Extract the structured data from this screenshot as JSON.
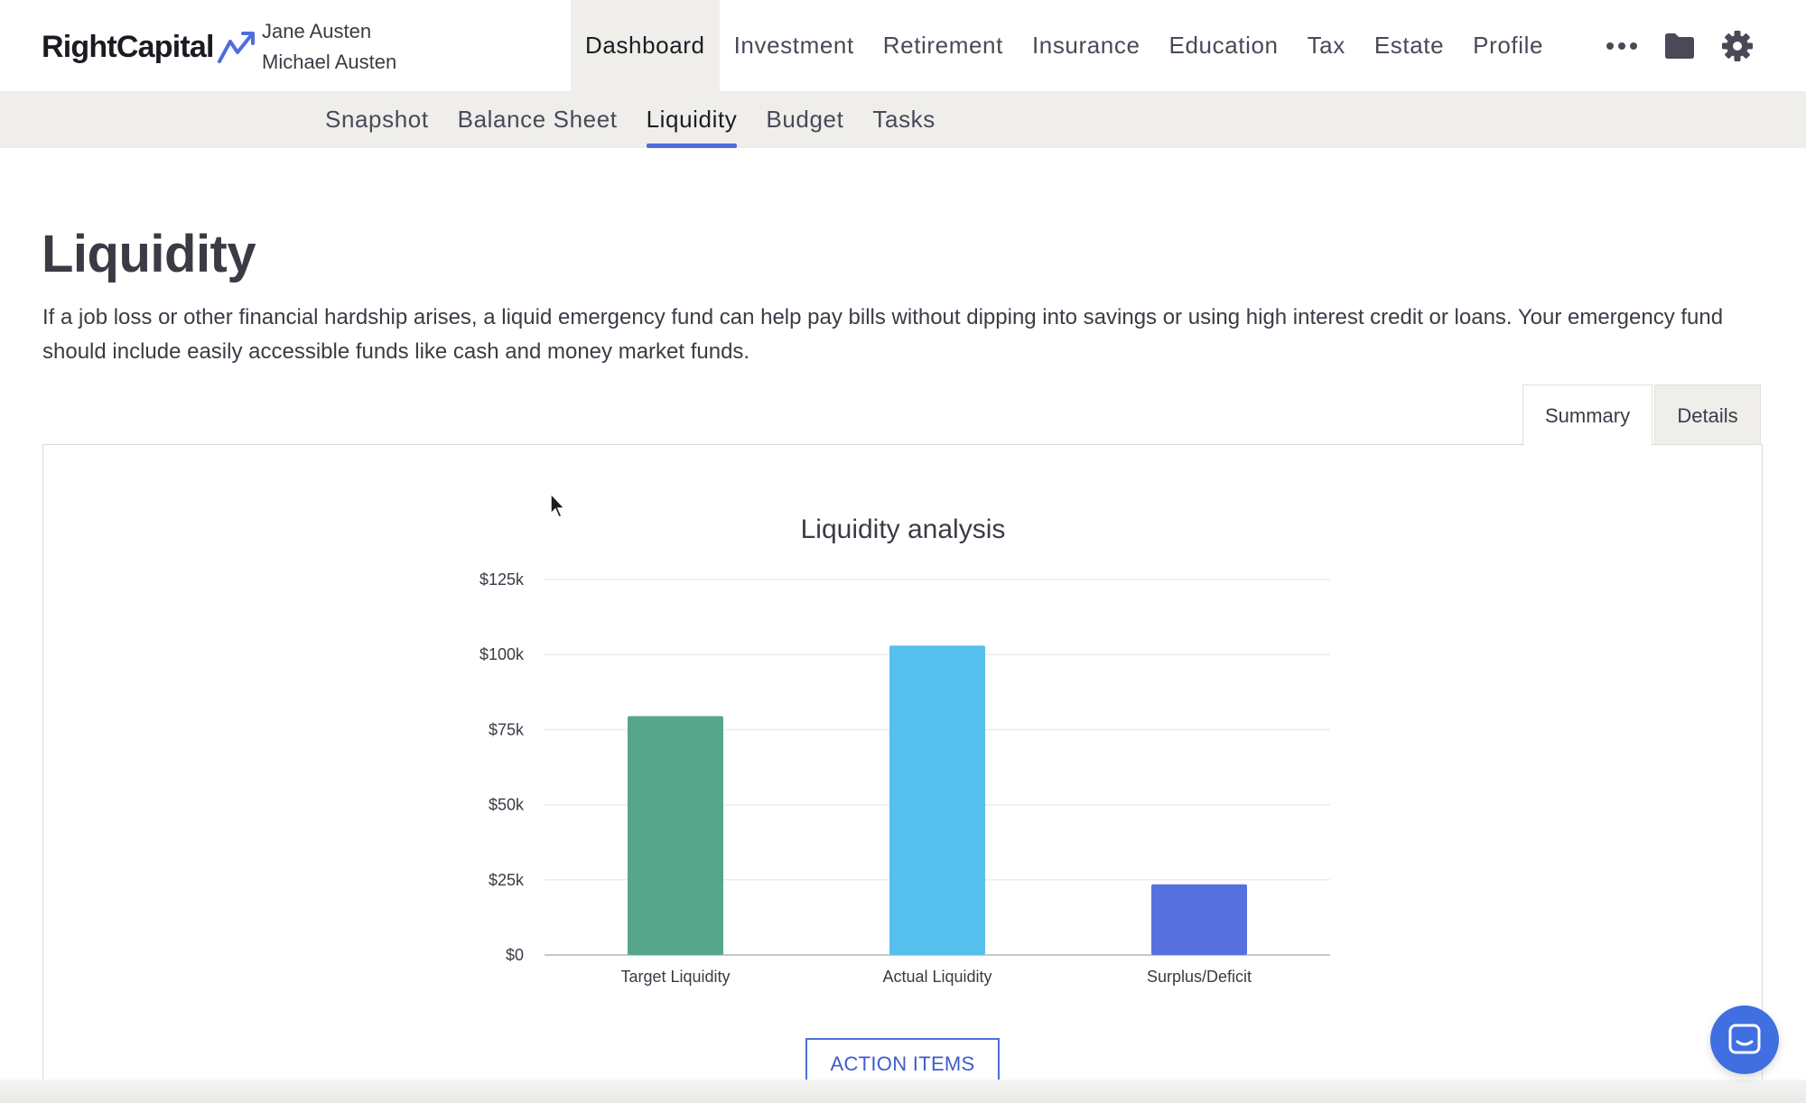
{
  "brand": {
    "logo_text": "RightCapital"
  },
  "clients": {
    "primary": "Jane Austen",
    "secondary": "Michael Austen"
  },
  "main_nav": [
    {
      "label": "Dashboard",
      "active": true
    },
    {
      "label": "Investment"
    },
    {
      "label": "Retirement"
    },
    {
      "label": "Insurance"
    },
    {
      "label": "Education"
    },
    {
      "label": "Tax"
    },
    {
      "label": "Estate"
    },
    {
      "label": "Profile"
    }
  ],
  "header_icons": [
    "more-icon",
    "folder-icon",
    "settings-gear-icon"
  ],
  "sub_nav": [
    {
      "label": "Snapshot"
    },
    {
      "label": "Balance Sheet"
    },
    {
      "label": "Liquidity",
      "active": true
    },
    {
      "label": "Budget"
    },
    {
      "label": "Tasks"
    }
  ],
  "page": {
    "title": "Liquidity",
    "description": "If a job loss or other financial hardship arises, a liquid emergency fund can help pay bills without dipping into savings or using high interest credit or loans. Your emergency fund should include easily accessible funds like cash and money market funds."
  },
  "tabs": {
    "summary": "Summary",
    "details": "Details"
  },
  "action_button": "ACTION ITEMS",
  "colors": {
    "accent": "#4f6ddc",
    "bar_target": "#55a68a",
    "bar_actual": "#55bfee",
    "bar_surplus": "#5670df"
  },
  "chart_data": {
    "type": "bar",
    "title": "Liquidity analysis",
    "categories": [
      "Target Liquidity",
      "Actual Liquidity",
      "Surplus/Deficit"
    ],
    "values": [
      79500,
      103000,
      23500
    ],
    "bar_colors": [
      "#55a68a",
      "#55bfee",
      "#5670df"
    ],
    "yticks": [
      0,
      25000,
      50000,
      75000,
      100000,
      125000
    ],
    "ytick_labels": [
      "$0",
      "$25k",
      "$50k",
      "$75k",
      "$100k",
      "$125k"
    ],
    "ylim": [
      0,
      125000
    ],
    "xlabel": "",
    "ylabel": "",
    "grid": true
  }
}
